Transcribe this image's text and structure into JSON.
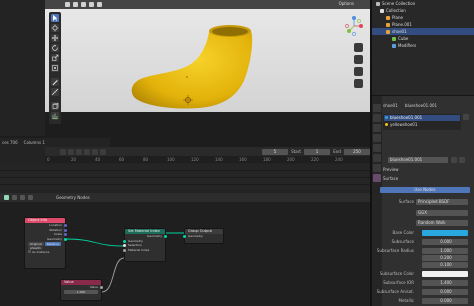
{
  "viewport": {
    "options_label": "Options",
    "accent": "#4f76b9",
    "object_color": "#f2c515"
  },
  "stats": {
    "verts": "ces 706",
    "columns": "Columns 1"
  },
  "timeline": {
    "ticks": [
      "0",
      "20",
      "40",
      "60",
      "80",
      "100",
      "120",
      "140",
      "160",
      "180",
      "200",
      "220",
      "240"
    ],
    "current_frame": "5",
    "start_label": "Start",
    "start_value": "1",
    "end_label": "End",
    "end_value": "250"
  },
  "node_editor": {
    "title": "Geometry Nodes",
    "nodes": {
      "object_info": {
        "title": "Object Info",
        "outputs": [
          "Location",
          "Rotation",
          "Scale",
          "Geometry"
        ],
        "mode_buttons": [
          "Original",
          "Relative"
        ],
        "object": "shoe01",
        "instance_label": "As Instance"
      },
      "set_material": {
        "title": "Set Material Index",
        "output": "Geometry",
        "inputs": [
          "Geometry",
          "Selection",
          "Material Index"
        ]
      },
      "group_output": {
        "title": "Group Output",
        "input": "Geometry"
      },
      "value": {
        "title": "Value",
        "output": "Value",
        "field": "1.000"
      }
    }
  },
  "outliner": {
    "rows": [
      "Scene Collection",
      "Collection",
      "Plane",
      "Plane.001",
      "shoe01",
      "Cube",
      "Modifiers"
    ]
  },
  "properties": {
    "top_items": [
      "shoe01",
      "blueshoe01.001"
    ],
    "slots": [
      "blueshoe01.001",
      "yellowshoe01"
    ],
    "material_field": "blueshoe01.001",
    "preview_label": "Preview",
    "surface_label": "Surface",
    "use_nodes_label": "Use Nodes",
    "surface_field_label": "Surface",
    "surface_value": "Principled BSDF",
    "distribution": "GGX",
    "subsurface_method": "Random Walk",
    "fields": [
      {
        "label": "Base Color",
        "value": ""
      },
      {
        "label": "Subsurface",
        "value": "0.000"
      },
      {
        "label": "Subsurface Radius",
        "value": "1.000"
      },
      {
        "label": "",
        "value": "0.200"
      },
      {
        "label": "",
        "value": "0.100"
      },
      {
        "label": "Subsurface Color",
        "value": ""
      },
      {
        "label": "Subsurface IOR",
        "value": "1.400"
      },
      {
        "label": "Subsurface Anisot.",
        "value": "0.000"
      },
      {
        "label": "Metallic",
        "value": "0.000"
      }
    ],
    "base_color": "#29a8e0",
    "subsurface_color": "#f0f0f0"
  }
}
